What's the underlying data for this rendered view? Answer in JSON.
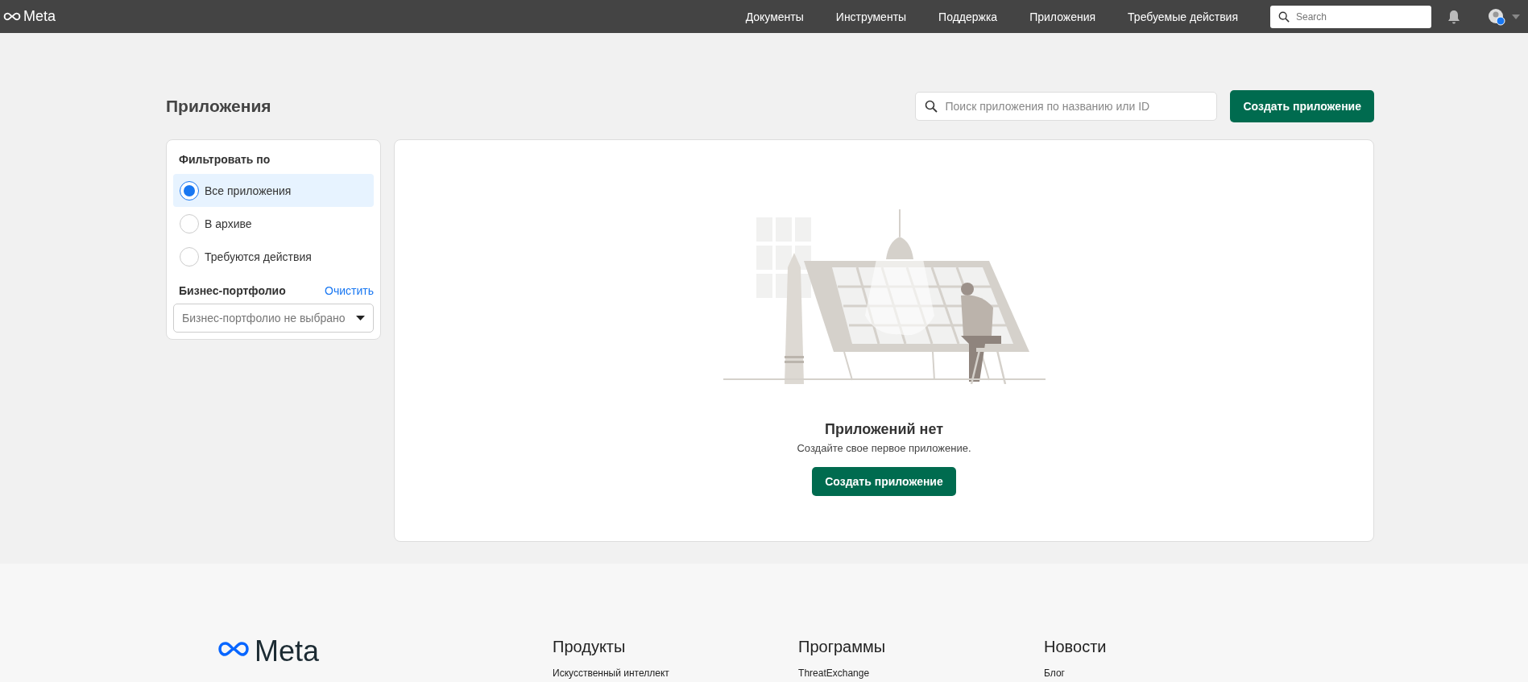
{
  "topbar": {
    "logo": "Meta",
    "nav": [
      "Документы",
      "Инструменты",
      "Поддержка",
      "Приложения",
      "Требуемые действия"
    ],
    "search": {
      "placeholder": "Search"
    }
  },
  "page": {
    "title": "Приложения",
    "search": {
      "placeholder": "Поиск приложения по названию или ID"
    },
    "create_button": "Создать приложение"
  },
  "filters": {
    "title": "Фильтровать по",
    "options": [
      {
        "label": "Все приложения",
        "selected": true
      },
      {
        "label": "В архиве",
        "selected": false
      },
      {
        "label": "Требуются действия",
        "selected": false
      }
    ],
    "portfolio": {
      "title": "Бизнес-портфолио",
      "clear": "Очистить",
      "select": {
        "placeholder": "Бизнес-портфолио не выбрано"
      }
    }
  },
  "empty": {
    "title": "Приложений нет",
    "text": "Создайте свое первое приложение.",
    "button": "Создать приложение"
  },
  "footer": {
    "logo": "Meta",
    "columns": [
      {
        "heading": "Продукты",
        "links": [
          "Искусственный интеллект"
        ]
      },
      {
        "heading": "Программы",
        "links": [
          "ThreatExchange"
        ]
      },
      {
        "heading": "Новости",
        "links": [
          "Блог"
        ]
      }
    ]
  }
}
